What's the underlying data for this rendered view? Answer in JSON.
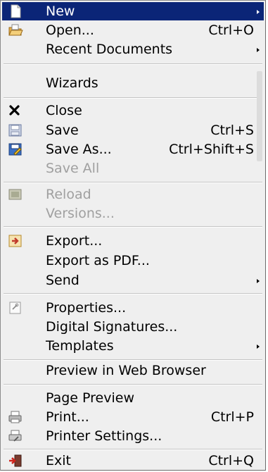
{
  "menu": {
    "new": {
      "label": "New",
      "icon": "new-document-icon"
    },
    "open": {
      "label": "Open...",
      "shortcut": "Ctrl+O",
      "icon": "open-folder-icon"
    },
    "recent": {
      "label": "Recent Documents"
    },
    "wizards": {
      "label": "Wizards"
    },
    "close": {
      "label": "Close",
      "icon": "close-x-icon"
    },
    "save": {
      "label": "Save",
      "shortcut": "Ctrl+S",
      "icon": "save-icon"
    },
    "save_as": {
      "label": "Save As...",
      "shortcut": "Ctrl+Shift+S",
      "icon": "save-as-icon"
    },
    "save_all": {
      "label": "Save All"
    },
    "reload": {
      "label": "Reload",
      "icon": "reload-icon"
    },
    "versions": {
      "label": "Versions..."
    },
    "export": {
      "label": "Export...",
      "icon": "export-icon"
    },
    "export_pdf": {
      "label": "Export as PDF..."
    },
    "send": {
      "label": "Send"
    },
    "properties": {
      "label": "Properties...",
      "icon": "properties-icon"
    },
    "digital_signatures": {
      "label": "Digital Signatures..."
    },
    "templates": {
      "label": "Templates"
    },
    "preview_web": {
      "label": "Preview in Web Browser"
    },
    "page_preview": {
      "label": "Page Preview"
    },
    "print": {
      "label": "Print...",
      "shortcut": "Ctrl+P",
      "icon": "printer-icon"
    },
    "printer_settings": {
      "label": "Printer Settings...",
      "icon": "printer-settings-icon"
    },
    "exit": {
      "label": "Exit",
      "shortcut": "Ctrl+Q",
      "icon": "exit-icon"
    }
  },
  "colors": {
    "menu_background": "#efefef",
    "highlight": "#0b2577",
    "disabled_text": "#a0a0a0"
  }
}
